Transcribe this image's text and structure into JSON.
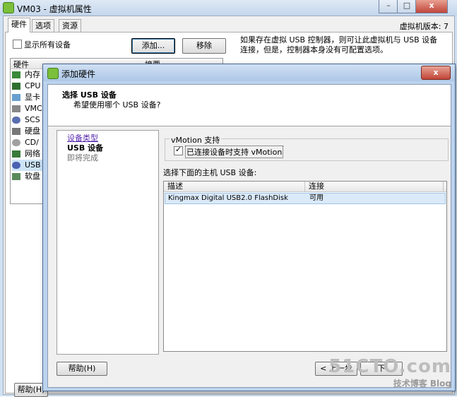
{
  "background_window": {
    "title": "VM03 - 虚拟机属性",
    "tabs": [
      "硬件",
      "选项",
      "资源"
    ],
    "active_tab": "硬件",
    "version": "虚拟机版本: 7",
    "show_all_devices_label": "显示所有设备",
    "add_button": "添加...",
    "remove_button": "移除",
    "info_text": "如果存在虚拟 USB 控制器，则可让此虚拟机与 USB 设备连接，但是，控制器本身没有可配置选项。",
    "hardware_list": {
      "header": "硬件",
      "header2": "摘要",
      "items": [
        "内存",
        "CPU",
        "显卡",
        "VMC",
        "SCS",
        "硬盘",
        "CD/",
        "网络",
        "USB",
        "软盘"
      ],
      "selected_index": 8
    },
    "help_button": "帮助(H)"
  },
  "dialog": {
    "title": "添加硬件",
    "header_title": "选择 USB 设备",
    "header_subtitle": "希望使用哪个 USB 设备?",
    "steps": [
      {
        "label": "设备类型",
        "state": "link"
      },
      {
        "label": "USB 设备",
        "state": "current"
      },
      {
        "label": "即将完成",
        "state": "pending"
      }
    ],
    "vmotion_group": "vMotion 支持",
    "vmotion_checkbox_label": "已连接设备时支持 vMotion",
    "vmotion_checked": true,
    "host_usb_label": "选择下面的主机 USB 设备:",
    "usb_table": {
      "columns": [
        "描述",
        "连接"
      ],
      "rows": [
        {
          "description": "Kingmax Digital USB2.0 FlashDisk",
          "connection": "可用"
        }
      ]
    },
    "help_button": "帮助(H)",
    "back_button": "< 上一步",
    "next_button": "下"
  },
  "watermark": {
    "line1": "51CTO.com",
    "line2": "技术博客 Blog"
  }
}
